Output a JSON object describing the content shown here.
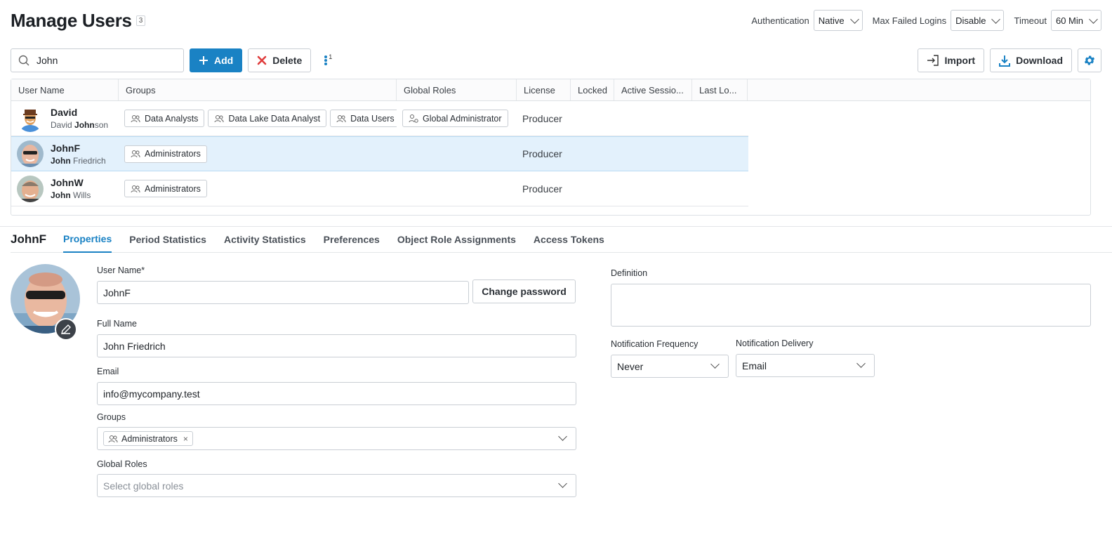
{
  "header": {
    "title": "Manage Users",
    "count": "3"
  },
  "settings": {
    "auth_label": "Authentication",
    "auth_value": "Native",
    "max_label": "Max Failed Logins",
    "max_value": "Disable",
    "timeout_label": "Timeout",
    "timeout_value": "60 Min"
  },
  "toolbar": {
    "search_value": "John",
    "add_label": "Add",
    "delete_label": "Delete",
    "more_count": "1",
    "import_label": "Import",
    "download_label": "Download"
  },
  "table": {
    "columns": [
      "User Name",
      "Groups",
      "Global Roles",
      "License",
      "Locked",
      "Active Sessio...",
      "Last Lo..."
    ],
    "rows": [
      {
        "username": "David",
        "fullname_pre": "David ",
        "fullname_bold": "John",
        "fullname_post": "son",
        "groups": [
          "Data Analysts",
          "Data Lake Data Analyst",
          "Data Users"
        ],
        "global_role": "Global Administrator",
        "license": "Producer"
      },
      {
        "username_bold": "John",
        "username_rest": "F",
        "fullname_bold": "John",
        "fullname_post": " Friedrich",
        "groups": [
          "Administrators"
        ],
        "license": "Producer"
      },
      {
        "username_bold": "John",
        "username_rest": "W",
        "fullname_bold": "John",
        "fullname_post": " Wills",
        "groups": [
          "Administrators"
        ],
        "license": "Producer"
      }
    ]
  },
  "detail": {
    "title": "JohnF",
    "tabs": [
      "Properties",
      "Period Statistics",
      "Activity Statistics",
      "Preferences",
      "Object Role Assignments",
      "Access Tokens"
    ],
    "form": {
      "username_label": "User Name*",
      "username_value": "JohnF",
      "change_password": "Change password",
      "fullname_label": "Full Name",
      "fullname_value": "John Friedrich",
      "email_label": "Email",
      "email_value": "info@mycompany.test",
      "groups_label": "Groups",
      "group_chip": "Administrators",
      "roles_label": "Global Roles",
      "roles_placeholder": "Select global roles",
      "definition_label": "Definition",
      "notif_freq_label": "Notification Frequency",
      "notif_freq_value": "Never",
      "notif_delivery_label": "Notification Delivery",
      "notif_delivery_value": "Email"
    }
  },
  "colors": {
    "accent": "#1a82c4",
    "selected_row": "#e3f1fc",
    "delete_red": "#e03c3c"
  }
}
